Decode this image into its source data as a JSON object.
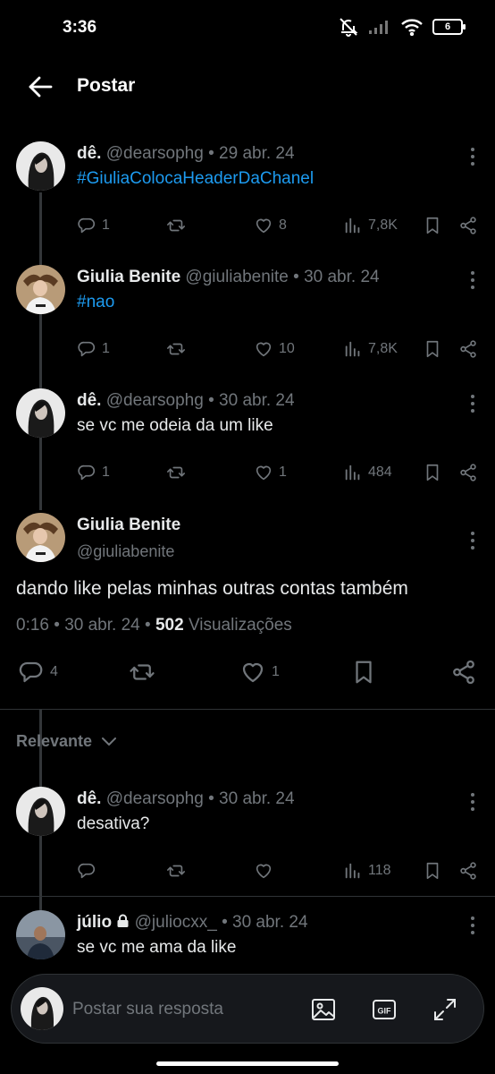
{
  "status_bar": {
    "time": "3:36",
    "battery": "6"
  },
  "header": {
    "title": "Postar"
  },
  "thread": [
    {
      "name": "dê.",
      "handle": "@dearsophg",
      "date": "29 abr. 24",
      "text": "#GiuliaColocaHeaderDaChanel",
      "text_is_hashtag": true,
      "replies": "1",
      "reposts": "",
      "likes": "8",
      "views": "7,8K"
    },
    {
      "name": "Giulia Benite",
      "handle": "@giuliabenite",
      "date": "30 abr. 24",
      "text": "#nao",
      "text_is_hashtag": true,
      "replies": "1",
      "reposts": "",
      "likes": "10",
      "views": "7,8K"
    },
    {
      "name": "dê.",
      "handle": "@dearsophg",
      "date": "30 abr. 24",
      "text": "se vc me odeia da um like",
      "text_is_hashtag": false,
      "replies": "1",
      "reposts": "",
      "likes": "1",
      "views": "484"
    }
  ],
  "main_post": {
    "name": "Giulia Benite",
    "handle": "@giuliabenite",
    "text": "dando like pelas minhas outras contas também",
    "time": "0:16",
    "date": "30 abr. 24",
    "views_count": "502",
    "views_label": "Visualizações",
    "replies": "4",
    "likes": "1"
  },
  "sort": {
    "label": "Relevante"
  },
  "replies": [
    {
      "name": "dê.",
      "handle": "@dearsophg",
      "date": "30 abr. 24",
      "text": "desativa?",
      "views": "118"
    },
    {
      "name": "júlio",
      "handle": "@juliocxx_",
      "date": "30 abr. 24",
      "text": "se vc me ama da like",
      "protected": true
    }
  ],
  "reply_bar": {
    "placeholder": "Postar sua resposta"
  },
  "colors": {
    "background": "#000000",
    "accent": "#1d9bf0",
    "muted": "#71767b",
    "text": "#e7e9ea"
  },
  "icons": [
    "back-arrow-icon",
    "reply-icon",
    "repost-icon",
    "like-icon",
    "views-icon",
    "bookmark-icon",
    "share-icon",
    "more-icon",
    "chevron-down-icon",
    "lock-icon",
    "image-icon",
    "gif-icon",
    "expand-icon"
  ]
}
